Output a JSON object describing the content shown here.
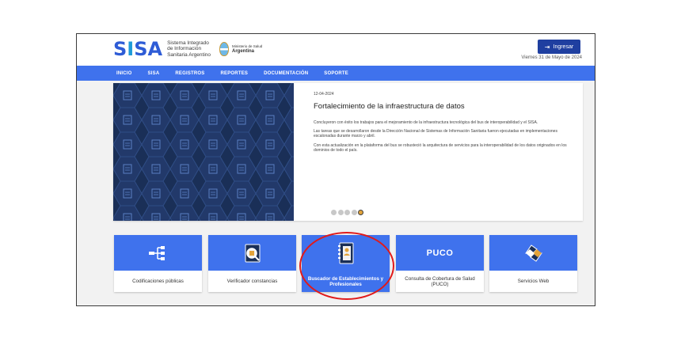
{
  "header": {
    "logo_main": "SISA",
    "logo_lines": [
      "Sistema Integrado",
      "de Información",
      "Sanitaria Argentino"
    ],
    "ministry_label": "Ministerio de Salud",
    "ministry_country": "Argentina",
    "login_label": "Ingresar",
    "date": "Viernes 31 de Mayo de 2024"
  },
  "nav": {
    "items": [
      "INICIO",
      "SISA",
      "REGISTROS",
      "REPORTES",
      "DOCUMENTACIÓN",
      "SOPORTE"
    ]
  },
  "news": {
    "date": "12-04-2024",
    "title": "Fortalecimiento de la infraestructura de datos",
    "paragraphs": [
      "Concluyeron con éxito los trabajos para el mejoramiento de la infraestructura tecnológica del bus de interoperabilidad y el SISA.",
      "Las tareas que se desarrollaron desde la Dirección Nacional de Sistemas de Información Sanitaria fueron ejecutadas en implementaciones escalonadas durante marzo y abril.",
      "Con esta actualización en la plataforma del bus se robusteció la arquitectura de servicios para la interoperabilidad de los datos originados en los dominios de todo el país."
    ],
    "slides_total": 5,
    "slide_active": 5
  },
  "cards": [
    {
      "label": "Codificaciones públicas",
      "icon": "hierarchy-icon"
    },
    {
      "label": "Verificador constancias",
      "icon": "document-search-icon"
    },
    {
      "label": "Buscador de Establecimientos y Profesionales",
      "icon": "directory-book-icon"
    },
    {
      "label": "Consulta de Cobertura de Salud (PUCO)",
      "icon": "puco-text",
      "icon_text": "PUCO"
    },
    {
      "label": "Servicios Web",
      "icon": "web-services-icon"
    }
  ],
  "colors": {
    "primary": "#3f72ed",
    "login_button": "#1f3fa0",
    "banner_background": "#1a2f57",
    "highlight": "#e11a1a"
  }
}
